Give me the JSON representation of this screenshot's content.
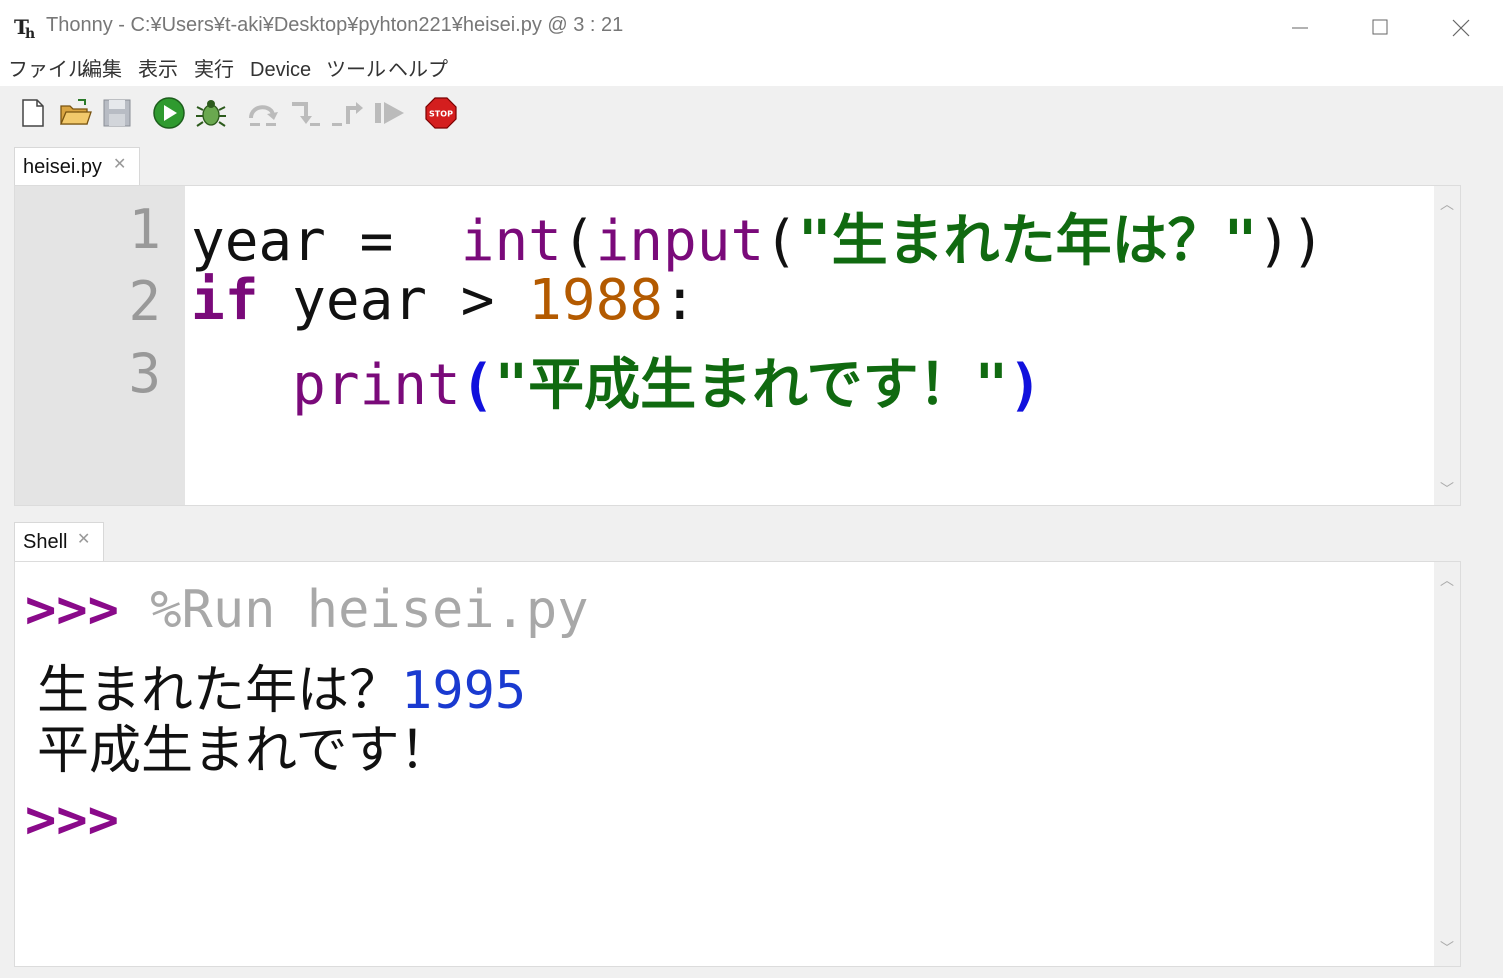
{
  "window": {
    "app_name": "Thonny",
    "title": "Thonny  -  C:¥Users¥t-aki¥Desktop¥pyhton221¥heisei.py  @  3 : 21"
  },
  "menu": [
    "ファイル",
    "編集",
    "表示",
    "実行",
    "Device",
    "ツール",
    "ヘルプ"
  ],
  "toolbar": {
    "icons": [
      "new-file-icon",
      "open-file-icon",
      "save-icon",
      "run-icon",
      "debug-icon",
      "step-over-icon",
      "step-into-icon",
      "step-out-icon",
      "resume-icon",
      "stop-icon"
    ],
    "stop_label": "STOP"
  },
  "editor": {
    "tab_label": "heisei.py",
    "line_numbers": [
      "1",
      "2",
      "3"
    ],
    "lines": [
      [
        {
          "t": "year = ",
          "c": ""
        },
        {
          "t": " int",
          "c": "builtin"
        },
        {
          "t": "(",
          "c": ""
        },
        {
          "t": "input",
          "c": "builtin"
        },
        {
          "t": "(",
          "c": ""
        },
        {
          "t": "\"生まれた年は？\"",
          "c": "str"
        },
        {
          "t": "))",
          "c": ""
        }
      ],
      [
        {
          "t": "if",
          "c": "kw"
        },
        {
          "t": " year > ",
          "c": ""
        },
        {
          "t": "1988",
          "c": "num"
        },
        {
          "t": ":",
          "c": ""
        }
      ],
      [
        {
          "t": "   ",
          "c": ""
        },
        {
          "t": "print",
          "c": "builtin"
        },
        {
          "t": "(",
          "c": "paren-hl"
        },
        {
          "t": "\"平成生まれです！\"",
          "c": "str"
        },
        {
          "t": ")",
          "c": "paren-hl"
        }
      ]
    ]
  },
  "shell": {
    "tab_label": "Shell",
    "prompt": ">>>",
    "run_command": " %Run heisei.py",
    "output_prompt_text": "生まれた年は？",
    "user_input": "1995",
    "output_result": "平成生まれです！"
  },
  "colors": {
    "keyword": "#7a0a7a",
    "string": "#106a10",
    "number": "#b35a00",
    "paren_highlight": "#1111dd",
    "shell_input": "#1a3ad0"
  }
}
